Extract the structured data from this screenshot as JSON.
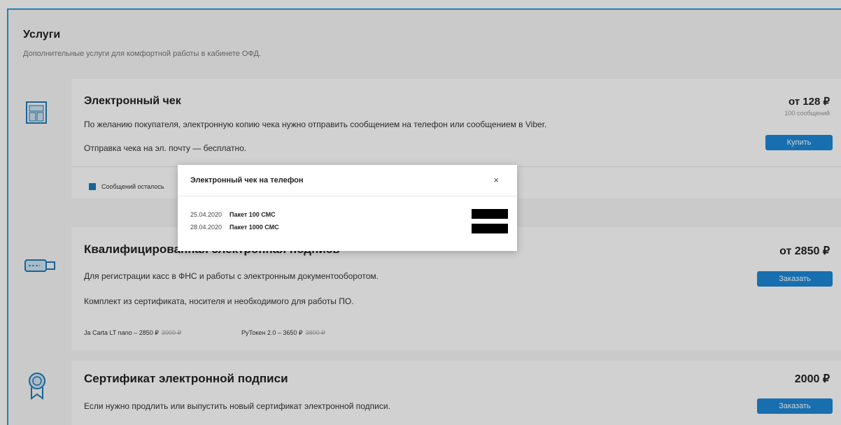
{
  "header": {
    "title": "Услуги",
    "subtitle": "Дополнительные услуги для комфортной работы в кабинете ОФД."
  },
  "cards": [
    {
      "title": "Электронный чек",
      "lines": [
        "По желанию покупателя, электронную копию чека нужно отправить сообщением на телефон или сообщением в Viber.",
        "Отправка чека на эл. почту — бесплатно."
      ],
      "price": "от 128 ₽",
      "price_note": "100 сообщений",
      "button": "Купить",
      "footer_label": "Сообщений осталось"
    },
    {
      "title": "Квалифицированная электронная подпись",
      "lines": [
        "Для регистрации касс в ФНС и работы с электронным документооборотом.",
        "Комплект из сертификата, носителя и необходимого для работы ПО."
      ],
      "price": "от 2850 ₽",
      "button": "Заказать",
      "options": [
        {
          "label": "Ja Carta LT nano – 2850 ₽",
          "old_price": "3000 ₽"
        },
        {
          "label": "РуТокен 2.0 – 3650 ₽",
          "old_price": "3800 ₽"
        }
      ]
    },
    {
      "title": "Сертификат электронной подписи",
      "lines": [
        "Если нужно продлить или выпустить новый сертификат электронной подписи."
      ],
      "price": "2000 ₽",
      "button": "Заказать"
    }
  ],
  "modal": {
    "title": "Электронный чек на телефон",
    "close": "×",
    "rows": [
      {
        "date": "25.04.2020",
        "name": "Пакет 100 СМС"
      },
      {
        "date": "28.04.2020",
        "name": "Пакет 1000 СМС"
      }
    ]
  },
  "colors": {
    "accent": "#1e88d6",
    "frame": "#2a9fd8"
  }
}
